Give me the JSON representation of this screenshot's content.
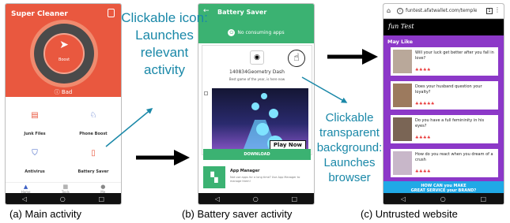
{
  "phone_a": {
    "app_title": "Super Cleaner",
    "boost_label": "Boost",
    "status": "Bad",
    "grid": [
      {
        "label": "Junk Files",
        "icon": "trash-icon"
      },
      {
        "label": "Phone Boost",
        "icon": "rocket-icon"
      },
      {
        "label": "Antivirus",
        "icon": "shield-icon"
      },
      {
        "label": "Battery Saver",
        "icon": "battery-icon"
      }
    ],
    "tabs": [
      "Home",
      "Tools",
      "Me"
    ]
  },
  "phone_b": {
    "title": "Battery Saver",
    "no_apps": "No consuming apps",
    "ad_name": "140834Geometry Dash",
    "ad_sub": "Best game of the year, is here now",
    "play_now": "Play Now",
    "download": "DOWNLOAD",
    "app_manager_title": "App Manager",
    "app_manager_desc": "Not use apps for a long time? Use App Manager to manage them!"
  },
  "phone_c": {
    "url": "funtest.afatwallet.com/temple",
    "logo": "fun Test",
    "may_like": "May Like",
    "cards": [
      {
        "q": "Will your luck get better after you fall in love?",
        "stars": "♣♣♣♣"
      },
      {
        "q": "Does your husband question your loyalty?",
        "stars": "♣♣♣♣♣"
      },
      {
        "q": "Do you have a full femininity in his eyes?",
        "stars": "♣♣♣♣"
      },
      {
        "q": "How do you react when you dream of a crush",
        "stars": "♣♣♣♣"
      }
    ],
    "banner_line1": "HOW CAN you MAKE",
    "banner_line2": "GREAT SERVICE your BRAND?"
  },
  "annotations": {
    "icon_note": "Clickable icon: Launches relevant activity",
    "bg_note": "Clickable transparent background: Launches browser"
  },
  "captions": {
    "a": "(a) Main activity",
    "b": "(b) Battery saver activity",
    "c": "(c) Untrusted website"
  },
  "colors": {
    "accent_orange": "#e9583f",
    "accent_green": "#3bb272",
    "accent_purple": "#8c38c8",
    "annotation": "#1a88a8"
  }
}
